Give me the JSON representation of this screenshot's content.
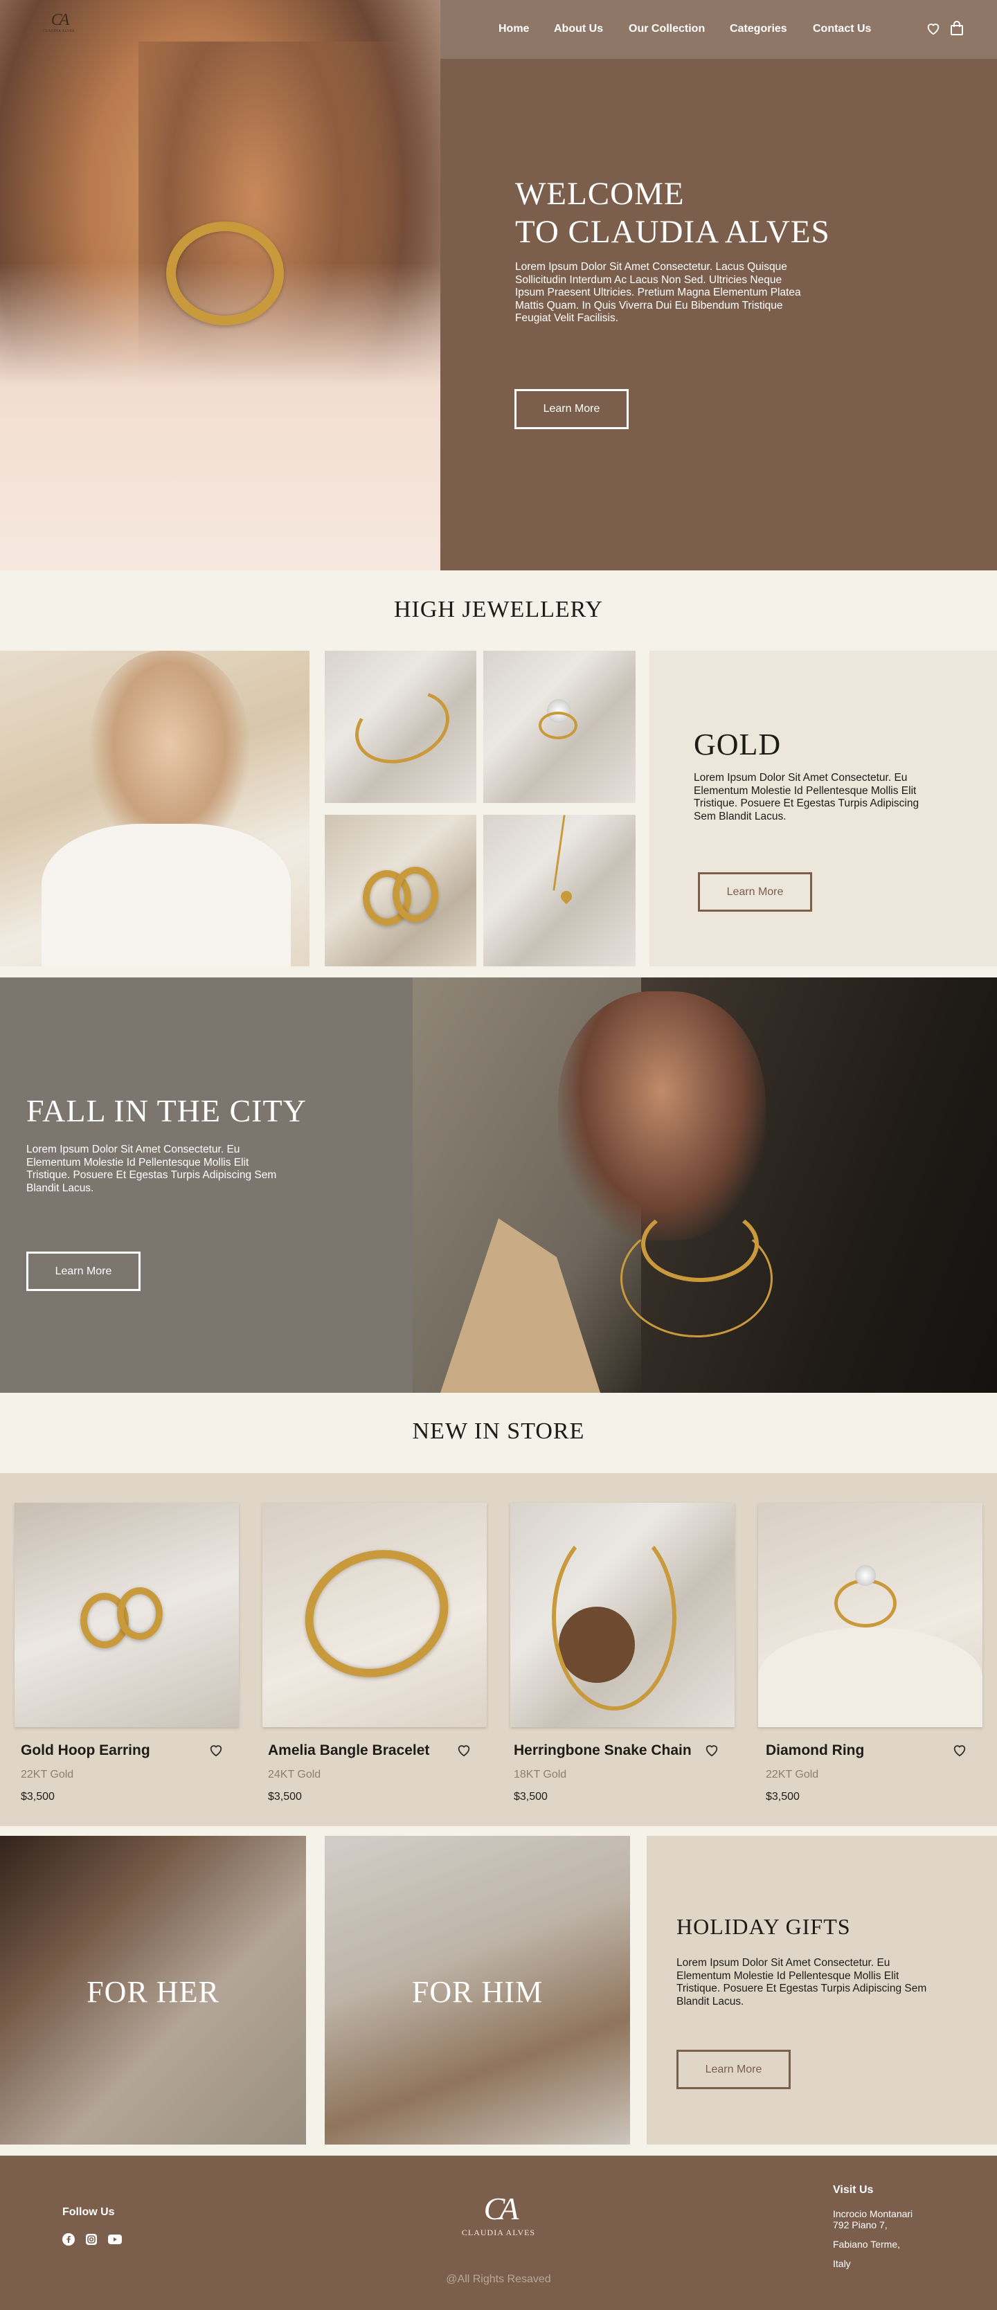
{
  "brand": {
    "name": "CLAUDIA ALVES",
    "monogram": "CA"
  },
  "nav": {
    "links": [
      "Home",
      "About Us",
      "Our Collection",
      "Categories",
      "Contact Us"
    ],
    "icons": [
      "heart-icon",
      "shopping-bag-icon"
    ]
  },
  "hero": {
    "title_line1": "WELCOME",
    "title_line2": "TO CLAUDIA ALVES",
    "body": "Lorem Ipsum Dolor Sit Amet Consectetur. Lacus Quisque Sollicitudin Interdum Ac Lacus Non Sed. Ultricies Neque Ipsum Praesent Ultricies. Pretium Magna Elementum Platea Mattis Quam. In Quis Viverra Dui Eu Bibendum Tristique Feugiat Velit Facilisis.",
    "cta": "Learn More"
  },
  "high_jewellery": {
    "title": "HIGH JEWELLERY",
    "gold": {
      "title": "GOLD",
      "body": "Lorem Ipsum Dolor Sit Amet Consectetur. Eu Elementum Molestie Id Pellentesque Mollis Elit Tristique. Posuere Et Egestas Turpis Adipiscing Sem Blandit Lacus.",
      "cta": "Learn More"
    }
  },
  "fall": {
    "title": "FALL IN THE CITY",
    "body": "Lorem Ipsum Dolor Sit Amet Consectetur. Eu Elementum Molestie Id Pellentesque Mollis Elit Tristique. Posuere Et Egestas Turpis Adipiscing Sem Blandit Lacus.",
    "cta": "Learn More"
  },
  "new_in_store": {
    "title": "NEW IN STORE",
    "products": [
      {
        "name": "Gold Hoop Earring",
        "material": "22KT Gold",
        "price": "$3,500"
      },
      {
        "name": "Amelia Bangle Bracelet",
        "material": "24KT Gold",
        "price": "$3,500"
      },
      {
        "name": "Herringbone Snake Chain",
        "material": "18KT Gold",
        "price": "$3,500"
      },
      {
        "name": "Diamond Ring",
        "material": "22KT Gold",
        "price": "$3,500"
      }
    ]
  },
  "gifts": {
    "for_her": "FOR HER",
    "for_him": "FOR HIM",
    "title": "HOLIDAY GIFTS",
    "body": "Lorem Ipsum Dolor Sit Amet Consectetur. Eu Elementum Molestie Id Pellentesque Mollis Elit Tristique. Posuere Et Egestas Turpis Adipiscing Sem Blandit Lacus.",
    "cta": "Learn More"
  },
  "footer": {
    "follow_title": "Follow Us",
    "social_icons": [
      "facebook-icon",
      "instagram-icon",
      "youtube-icon"
    ],
    "brand_name": "CLAUDIA ALVES",
    "visit_title": "Visit Us",
    "address_line1": "Incrocio Montanari",
    "address_line2": "792 Piano 7,",
    "address_line3": "Fabiano Terme,",
    "address_line4": "Italy",
    "copyright": "@All Rights Resaved"
  },
  "colors": {
    "brown": "#7b5e4b",
    "cream": "#f5f2ea",
    "taupe": "#7d766e",
    "beige": "#e0d6c8"
  }
}
